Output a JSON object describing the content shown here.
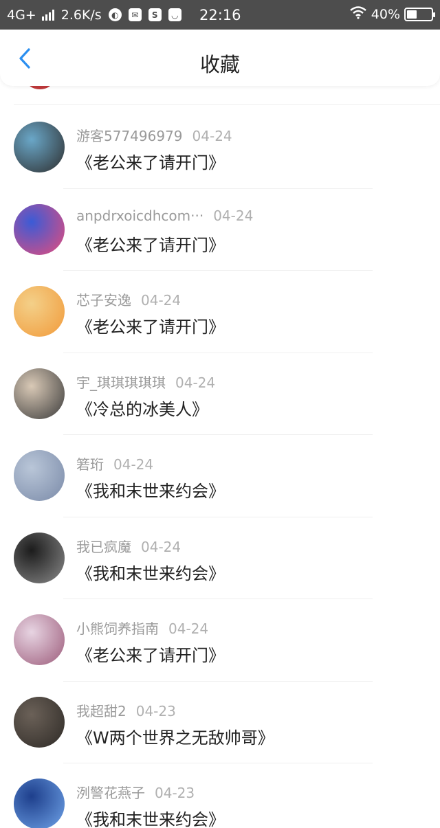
{
  "status_bar": {
    "network": "4G+",
    "speed": "2.6K/s",
    "time": "22:16",
    "battery": "40%",
    "battery_level": 0.4,
    "app_icons": [
      "browser-icon",
      "mail-icon",
      "s-app-icon",
      "chat-icon"
    ]
  },
  "header": {
    "title": "收藏",
    "back_icon": "chevron-left-icon",
    "accent_color": "#2b8ff0"
  },
  "favorites": [
    {
      "user": "游客577496979",
      "date": "04-24",
      "book": "《老公来了请开门》"
    },
    {
      "user": "anpdrxoicdhcom···",
      "date": "04-24",
      "book": "《老公来了请开门》"
    },
    {
      "user": "芯子安逸",
      "date": "04-24",
      "book": "《老公来了请开门》"
    },
    {
      "user": "宇_琪琪琪琪琪",
      "date": "04-24",
      "book": "《冷总的冰美人》"
    },
    {
      "user": "箬珩",
      "date": "04-24",
      "book": "《我和末世来约会》"
    },
    {
      "user": "我已疯魔",
      "date": "04-24",
      "book": "《我和末世来约会》"
    },
    {
      "user": "小熊饲养指南",
      "date": "04-24",
      "book": "《老公来了请开门》"
    },
    {
      "user": "我超甜2",
      "date": "04-23",
      "book": "《W两个世界之无敌帅哥》"
    },
    {
      "user": "洌警花燕子",
      "date": "04-23",
      "book": "《我和末世来约会》"
    }
  ]
}
